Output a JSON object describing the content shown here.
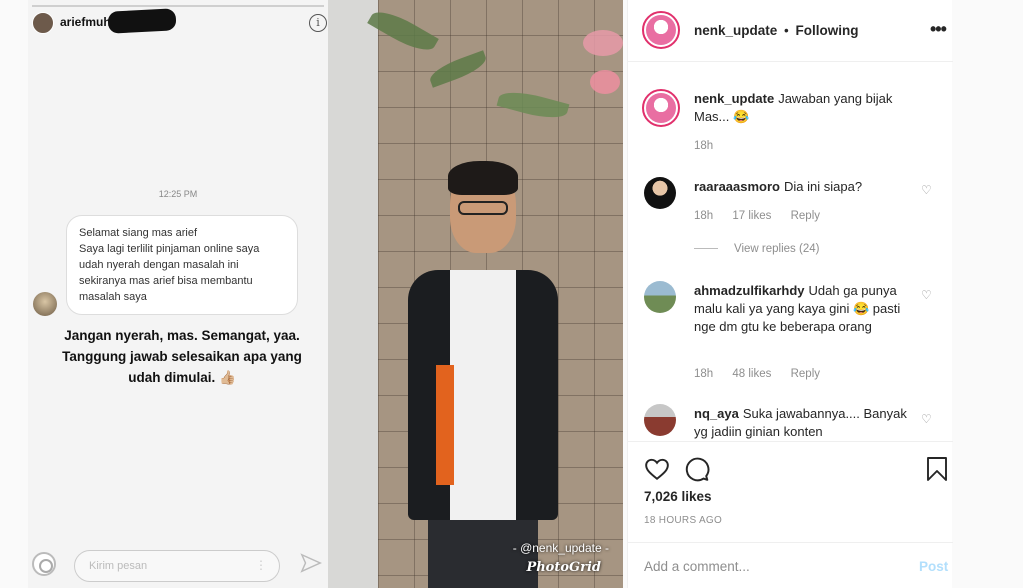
{
  "story": {
    "username": "ariefmuhammad",
    "info_icon": "i",
    "time": "12:25 PM",
    "dm_lines": [
      "Selamat siang mas arief",
      "Saya lagi terlilit pinjaman online saya",
      "udah nyerah dengan masalah ini",
      "sekiranya mas arief bisa membantu",
      "masalah saya"
    ],
    "caption": "Jangan nyerah, mas. Semangat, yaa. Tanggung jawab selesaikan apa yang udah dimulai. 👍🏼",
    "input_placeholder": "Kirim pesan",
    "dots": "⋮"
  },
  "photo": {
    "watermark": "- @nenk_update -",
    "photogrid": "PhotoGrid"
  },
  "header": {
    "username": "nenk_update",
    "separator": "•",
    "follow_status": "Following",
    "more": "•••"
  },
  "caption_comment": {
    "username": "nenk_update",
    "text": "Jawaban yang bijak Mas... 😂",
    "time": "18h"
  },
  "comments": [
    {
      "username": "raaraaasmoro",
      "text": "Dia ini siapa?",
      "time": "18h",
      "likes": "17 likes",
      "reply": "Reply",
      "view_replies": "View replies (24)"
    },
    {
      "username": "ahmadzulfikarhdy",
      "text": "Udah ga punya malu kali ya yang kaya gini 😂 pasti nge dm gtu ke beberapa orang",
      "time": "18h",
      "likes": "48 likes",
      "reply": "Reply"
    },
    {
      "username": "nq_aya",
      "text": "Suka jawabannya.... Banyak yg jadiin ginian konten"
    }
  ],
  "actions": {
    "likes": "7,026 likes",
    "time_ago": "18 HOURS AGO",
    "add_comment_placeholder": "Add a comment...",
    "post": "Post"
  },
  "icons": {
    "heart": "heart-icon",
    "comment": "comment-icon",
    "save": "bookmark-icon",
    "more": "more-options-icon",
    "small_heart": "♡"
  },
  "colors": {
    "avatar_ring": "#e1306c",
    "post_disabled": "#b2dffc",
    "muted": "#8e8e8e"
  }
}
